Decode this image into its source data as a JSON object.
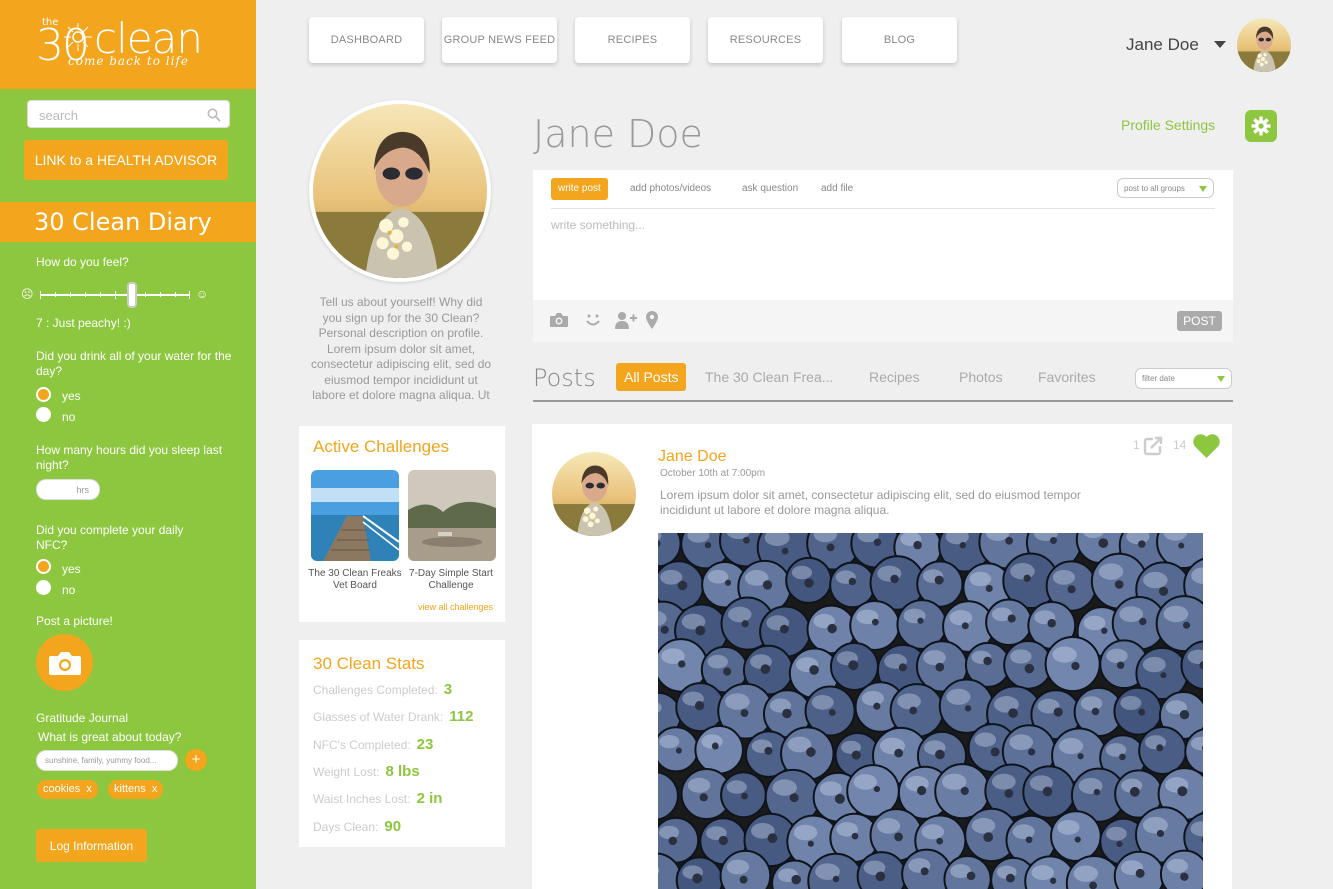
{
  "brand": {
    "the": "the",
    "number": "30",
    "name": "clean",
    "tagline": "come back to life",
    "primary_color": "#f3a51d",
    "secondary_color": "#8dc63f"
  },
  "sidebar": {
    "search_placeholder": "search",
    "advisor_button": "LINK to a HEALTH ADVISOR",
    "diary_title": "30 Clean Diary",
    "feel_question": "How do you feel?",
    "feel_value_text": "7 : Just peachy!  :)",
    "feel_level": 7,
    "water_question": "Did you drink all of your water for the day?",
    "water_yes": "yes",
    "water_no": "no",
    "water_selected": "yes",
    "sleep_question": "How many hours did you sleep last night?",
    "sleep_placeholder": "hrs",
    "nfc_question": "Did you complete your daily NFC?",
    "nfc_yes": "yes",
    "nfc_no": "no",
    "nfc_selected": "yes",
    "picture_label": "Post a picture!",
    "journal_title": "Gratitude Journal",
    "journal_question": "What is great about today?",
    "journal_placeholder": "sunshine, family, yummy food...",
    "journal_add": "+",
    "chips": [
      "cookies",
      "kittens"
    ],
    "chip_remove": "x",
    "log_button": "Log Information"
  },
  "nav": {
    "items": [
      "DASHBOARD",
      "GROUP NEWS FEED",
      "RECIPES",
      "RESOURCES",
      "BLOG"
    ],
    "user_name": "Jane Doe"
  },
  "profile": {
    "name": "Jane Doe",
    "about": "Tell us about yourself! Why did you sign up for the 30 Clean? Personal description on profile. Lorem ipsum dolor sit amet, consectetur adipiscing elit, sed do eiusmod tempor incididunt ut labore et dolore magna aliqua. Ut",
    "settings_label": "Profile Settings"
  },
  "challenges": {
    "title": "Active Challenges",
    "items": [
      "The 30 Clean Freaks Vet Board",
      "7-Day Simple Start Challenge"
    ],
    "view_all": "view all challenges"
  },
  "stats": {
    "title": "30 Clean Stats",
    "rows": [
      {
        "label": "Challenges Completed:",
        "value": "3"
      },
      {
        "label": "Glasses of Water Drank:",
        "value": "112"
      },
      {
        "label": "NFC's Completed:",
        "value": "23"
      },
      {
        "label": "Weight Lost:",
        "value": "8 lbs"
      },
      {
        "label": "Waist Inches Lost:",
        "value": "2 in"
      },
      {
        "label": "Days Clean:",
        "value": "90"
      }
    ]
  },
  "composer": {
    "tabs": [
      "write post",
      "add photos/videos",
      "ask question",
      "add file"
    ],
    "active_tab": "write post",
    "audience": "post to all groups",
    "placeholder": "write something...",
    "post_button": "POST",
    "tool_icons": [
      "camera-icon",
      "smiley-icon",
      "add-person-icon",
      "location-pin-icon"
    ]
  },
  "posts": {
    "heading": "Posts",
    "tabs": [
      "All Posts",
      "The 30 Clean Frea...",
      "Recipes",
      "Photos",
      "Favorites"
    ],
    "active_tab": "All Posts",
    "filter_placeholder": "filter date"
  },
  "post": {
    "author": "Jane Doe",
    "date": "October 10th at 7:00pm",
    "body": "Lorem ipsum dolor sit amet, consectetur adipiscing elit, sed do eiusmod tempor incididunt ut labore et dolore magna aliqua.",
    "share_count": "1",
    "like_count": "14"
  }
}
